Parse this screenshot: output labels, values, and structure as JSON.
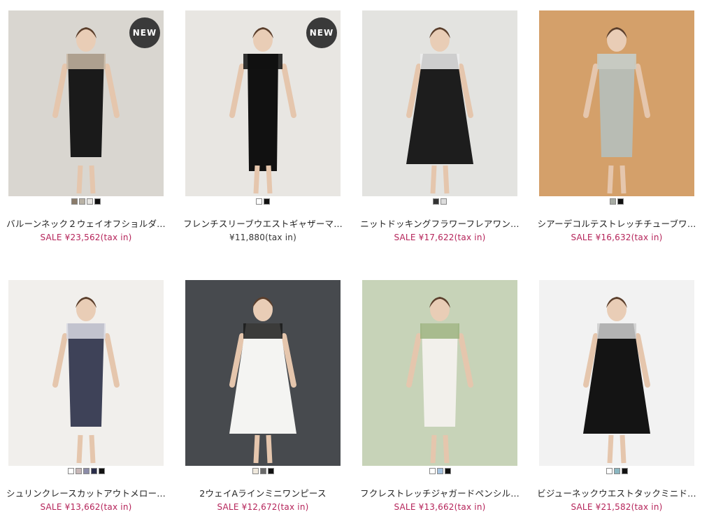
{
  "badge_label": "NEW",
  "products": [
    {
      "name": "バルーンネック２ウェイオフショルダ…",
      "price": "SALE ¥23,562(tax in)",
      "sale": true,
      "new": true,
      "swatches": [
        "#8a7b6a",
        "#b9b2a6",
        "#e8e6e2",
        "#111111"
      ],
      "bg": "#d9d6d0",
      "outfit": "#1a1a1a",
      "accent": "#c9b8a5",
      "icon": "balloon-offshoulder-photo"
    },
    {
      "name": "フレンチスリーブウエストギャザーマ…",
      "price": "¥11,880(tax in)",
      "sale": false,
      "new": true,
      "swatches": [
        "#ffffff",
        "#111111"
      ],
      "bg": "#e8e6e2",
      "outfit": "#111111",
      "accent": "#111111",
      "icon": "french-sleeve-maxi-photo"
    },
    {
      "name": "ニットドッキングフラワーフレアワン…",
      "price": "SALE ¥17,622(tax in)",
      "sale": true,
      "new": false,
      "swatches": [
        "#333333",
        "#dddddd"
      ],
      "bg": "#e3e3e0",
      "outfit": "#1d1d1d",
      "accent": "#ededed",
      "icon": "flower-flare-dress-photo"
    },
    {
      "name": "シアーデコルテストレッチチューブワ…",
      "price": "SALE ¥16,632(tax in)",
      "sale": true,
      "new": false,
      "swatches": [
        "#a7aca4",
        "#111111"
      ],
      "bg": "#d4a06a",
      "outfit": "#b8bcb4",
      "accent": "#c9ccc4",
      "icon": "sheer-tube-dress-photo"
    },
    {
      "name": "シュリンクレースカットアウトメロー…",
      "price": "SALE ¥13,662(tax in)",
      "sale": true,
      "new": false,
      "swatches": [
        "#ffffff",
        "#c8b8b8",
        "#8c8ca8",
        "#2a2e4a",
        "#111111"
      ],
      "bg": "#f1efec",
      "outfit": "#3e4258",
      "accent": "#d9d9e3",
      "icon": "lace-cutout-dress-photo"
    },
    {
      "name": "2ウェイAラインミニワンピース",
      "price": "SALE ¥12,672(tax in)",
      "sale": true,
      "new": false,
      "swatches": [
        "#efe8dc",
        "#6a6a6a",
        "#111111"
      ],
      "bg": "#474a4e",
      "outfit": "#f4f4f2",
      "accent": "#1a1a1a",
      "icon": "a-line-mini-dress-photo"
    },
    {
      "name": "フクレストレッチジャガードペンシル…",
      "price": "SALE ¥13,662(tax in)",
      "sale": true,
      "new": false,
      "swatches": [
        "#ffffff",
        "#a6c3e0",
        "#111111"
      ],
      "bg": "#c7d3b8",
      "outfit": "#f2f0eb",
      "accent": "#9bb27e",
      "icon": "jacquard-pencil-dress-photo"
    },
    {
      "name": "ビジューネックウエストタックミニド…",
      "price": "SALE ¥21,582(tax in)",
      "sale": true,
      "new": false,
      "swatches": [
        "#ffffff",
        "#8ab6c0",
        "#111111"
      ],
      "bg": "#f2f2f2",
      "outfit": "#141414",
      "accent": "#cfcfcf",
      "icon": "bijou-neck-mini-dress-photo"
    }
  ]
}
